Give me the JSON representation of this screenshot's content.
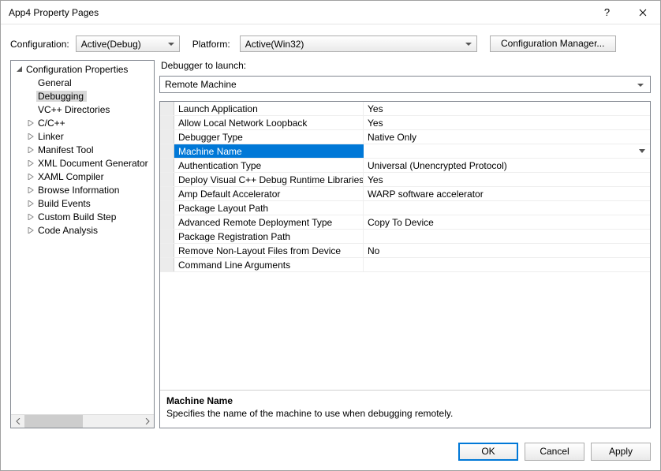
{
  "title": "App4 Property Pages",
  "configRow": {
    "configurationLabel": "Configuration:",
    "configurationValue": "Active(Debug)",
    "platformLabel": "Platform:",
    "platformValue": "Active(Win32)",
    "configManagerLabel": "Configuration Manager..."
  },
  "tree": {
    "root": "Configuration Properties",
    "items": [
      {
        "label": "General",
        "expandable": false
      },
      {
        "label": "Debugging",
        "expandable": false,
        "selected": true
      },
      {
        "label": "VC++ Directories",
        "expandable": false
      },
      {
        "label": "C/C++",
        "expandable": true
      },
      {
        "label": "Linker",
        "expandable": true
      },
      {
        "label": "Manifest Tool",
        "expandable": true
      },
      {
        "label": "XML Document Generator",
        "expandable": true
      },
      {
        "label": "XAML Compiler",
        "expandable": true
      },
      {
        "label": "Browse Information",
        "expandable": true
      },
      {
        "label": "Build Events",
        "expandable": true
      },
      {
        "label": "Custom Build Step",
        "expandable": true
      },
      {
        "label": "Code Analysis",
        "expandable": true
      }
    ]
  },
  "launchLabel": "Debugger to launch:",
  "launchValue": "Remote Machine",
  "grid": {
    "rows": [
      {
        "name": "Launch Application",
        "value": "Yes"
      },
      {
        "name": "Allow Local Network Loopback",
        "value": "Yes"
      },
      {
        "name": "Debugger Type",
        "value": "Native Only"
      },
      {
        "name": "Machine Name",
        "value": "",
        "selected": true
      },
      {
        "name": "Authentication Type",
        "value": "Universal (Unencrypted Protocol)"
      },
      {
        "name": "Deploy Visual C++ Debug Runtime Libraries",
        "value": "Yes"
      },
      {
        "name": "Amp Default Accelerator",
        "value": "WARP software accelerator"
      },
      {
        "name": "Package Layout Path",
        "value": ""
      },
      {
        "name": "Advanced Remote Deployment Type",
        "value": "Copy To Device"
      },
      {
        "name": "Package Registration Path",
        "value": ""
      },
      {
        "name": "Remove Non-Layout Files from Device",
        "value": "No"
      },
      {
        "name": "Command Line Arguments",
        "value": ""
      }
    ]
  },
  "description": {
    "title": "Machine Name",
    "text": "Specifies the name of the machine to use when debugging remotely."
  },
  "footer": {
    "ok": "OK",
    "cancel": "Cancel",
    "apply": "Apply"
  }
}
